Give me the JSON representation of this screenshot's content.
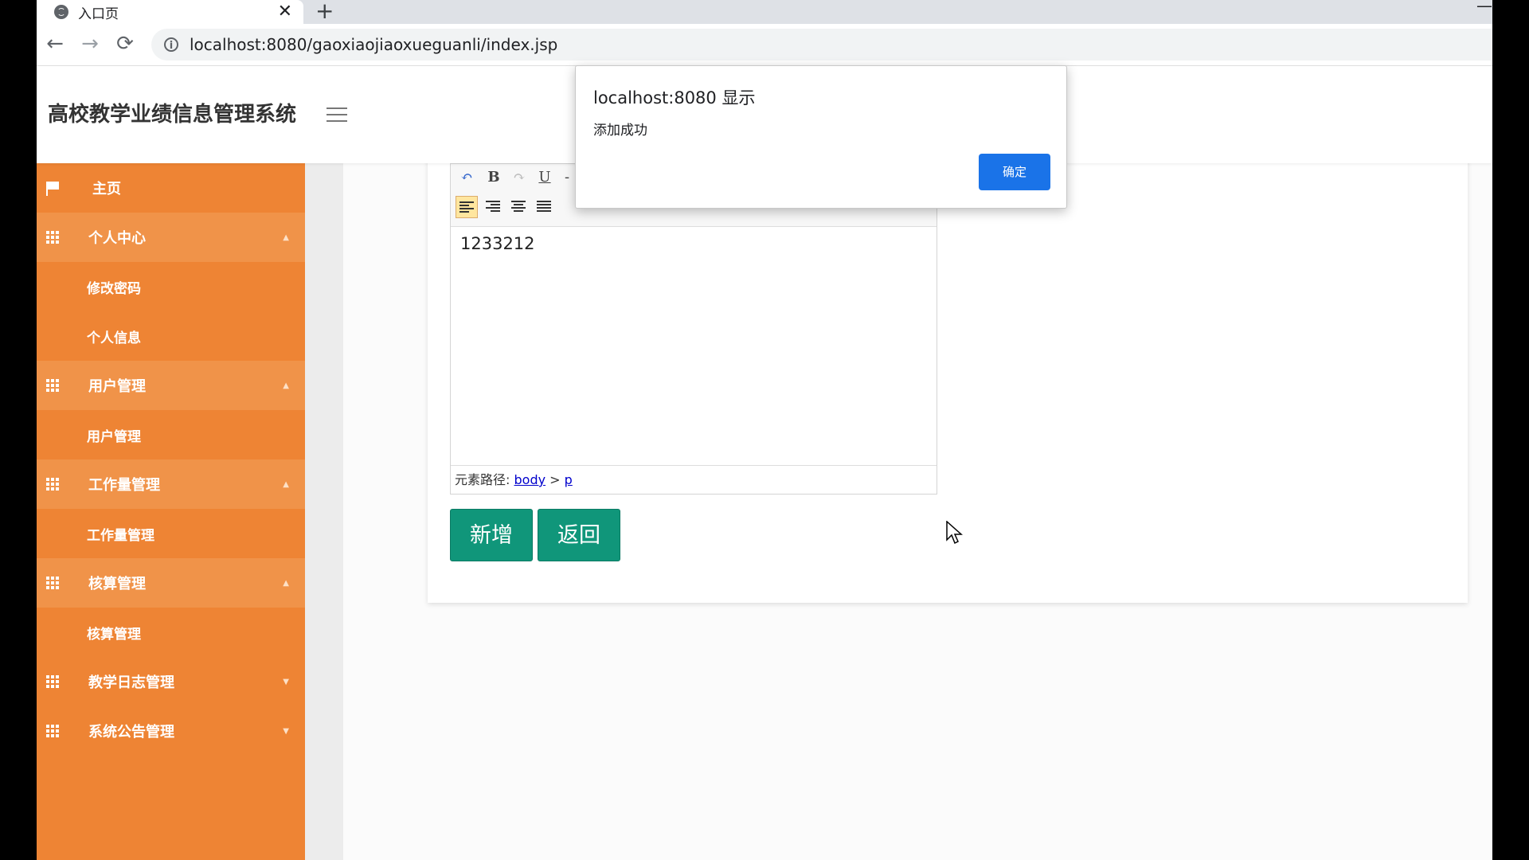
{
  "browser": {
    "tab_title": "入口页",
    "tab_close": "✕",
    "new_tab": "+",
    "minimize": "—",
    "url": "localhost:8080/gaoxiaojiaoxueguanli/index.jsp",
    "nav": {
      "back": "←",
      "forward": "→",
      "reload": "⟳",
      "info": "i"
    }
  },
  "app": {
    "title": "高校教学业绩信息管理系统"
  },
  "sidebar": {
    "home": "主页",
    "groups": [
      {
        "label": "个人中心",
        "caret": "▲",
        "items": [
          "修改密码",
          "个人信息"
        ]
      },
      {
        "label": "用户管理",
        "caret": "▲",
        "items": [
          "用户管理"
        ]
      },
      {
        "label": "工作量管理",
        "caret": "▲",
        "items": [
          "工作量管理"
        ]
      },
      {
        "label": "核算管理",
        "caret": "▲",
        "items": [
          "核算管理"
        ]
      },
      {
        "label": "教学日志管理",
        "caret": "▼",
        "items": []
      },
      {
        "label": "系统公告管理",
        "caret": "▼",
        "items": []
      }
    ]
  },
  "editor": {
    "toolbar": {
      "undo": "↶",
      "bold": "B",
      "redo": "↷",
      "underline": "U",
      "strike": "-"
    },
    "content": "1233212",
    "path_label": "元素路径:",
    "path_body": "body",
    "path_sep": ">",
    "path_p": "p"
  },
  "buttons": {
    "add": "新增",
    "back": "返回"
  },
  "dialog": {
    "title": "localhost:8080 显示",
    "message": "添加成功",
    "ok": "确定"
  },
  "colors": {
    "sidebar": "#ee8434",
    "sidebar_group": "#f09349",
    "primary_button": "#10967a",
    "dialog_button": "#1a73e8"
  }
}
